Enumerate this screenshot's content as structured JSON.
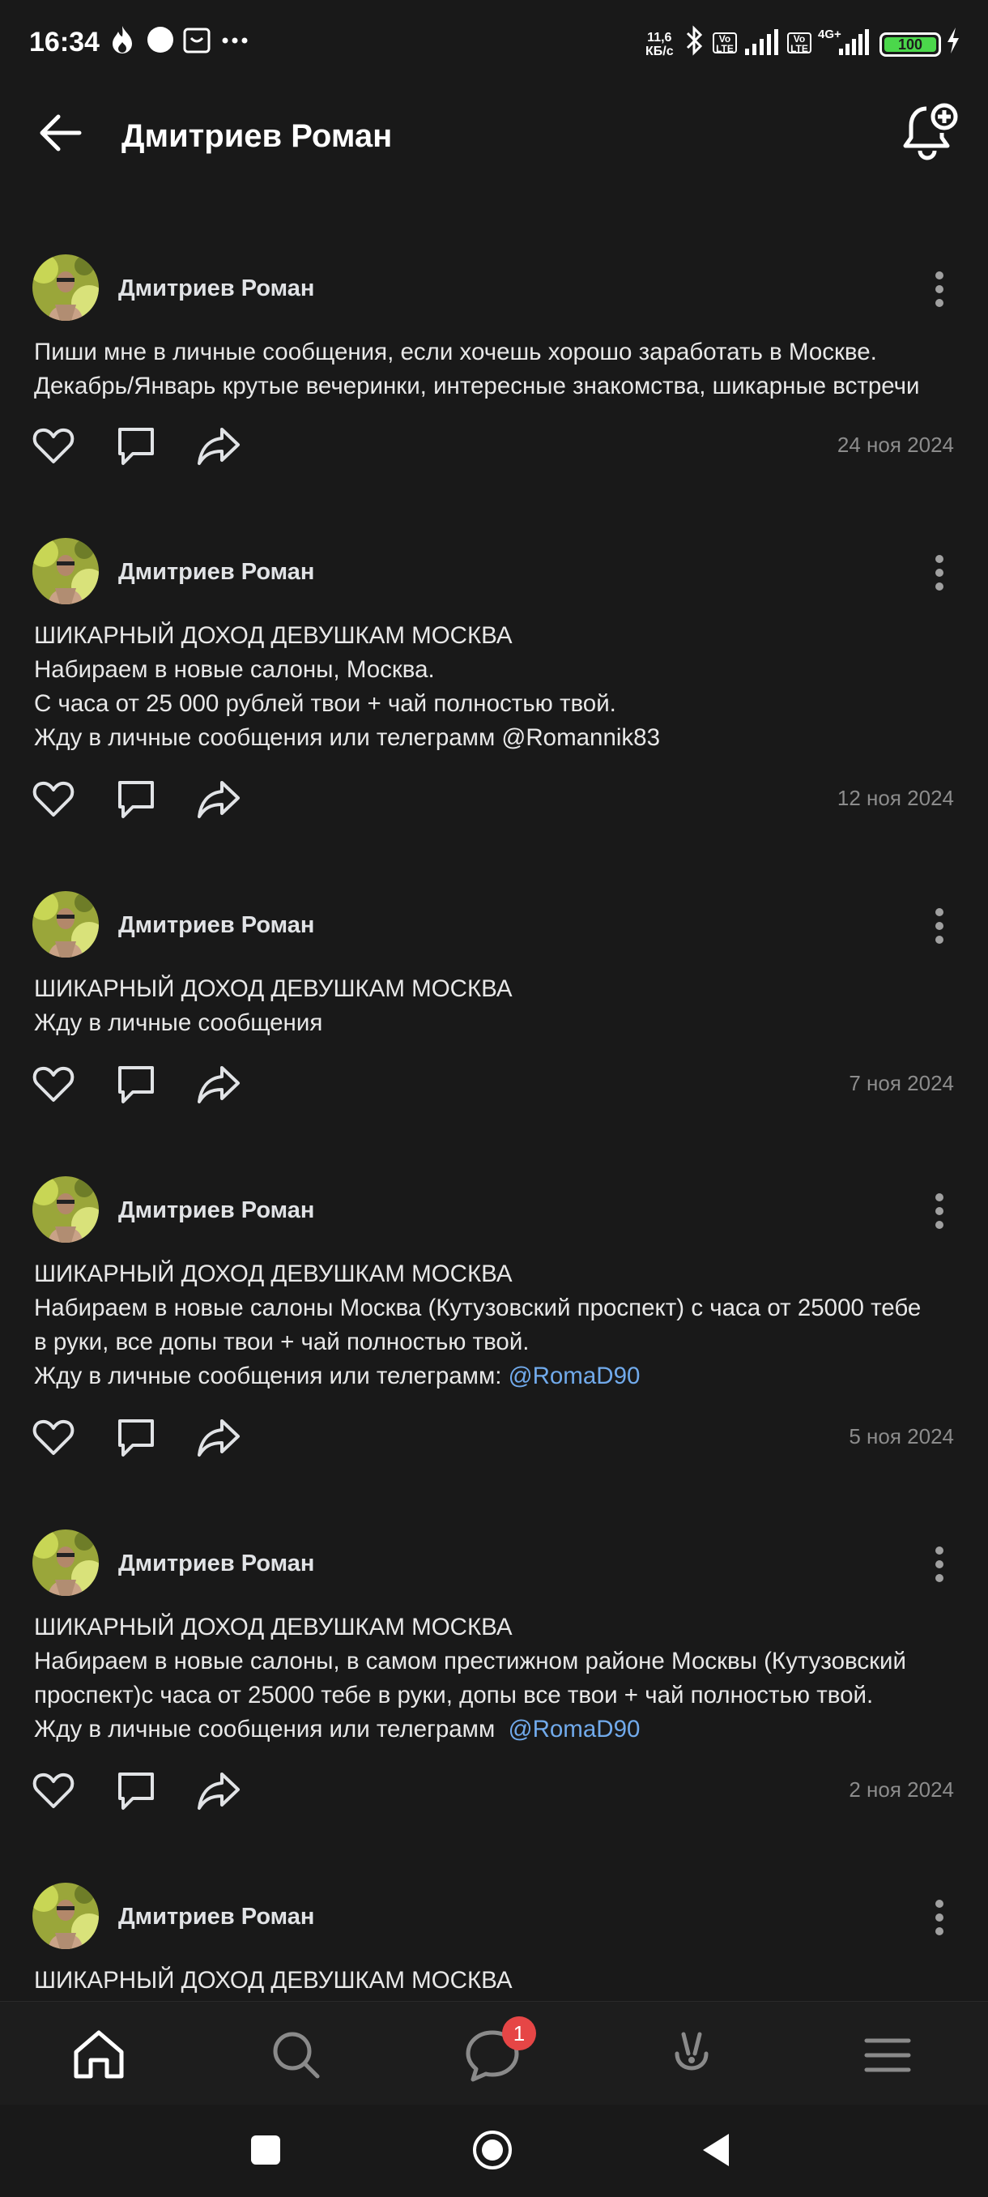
{
  "status_bar": {
    "time": "16:34",
    "net_speed_value": "11,6",
    "net_speed_unit": "КБ/с",
    "lte1": "Vo LTE",
    "lte2": "Vo LTE",
    "network": "4G+",
    "battery": "100",
    "icons": [
      "flame-icon",
      "circle-icon",
      "smile-box-icon",
      "more-dots-icon",
      "bluetooth-icon",
      "signal-icon",
      "charging-icon"
    ]
  },
  "header": {
    "title": "Дмитриев Роман",
    "back_icon": "arrow-left-icon",
    "bell_icon": "bell-plus-icon"
  },
  "posts": [
    {
      "author": "Дмитриев Роман",
      "lines": [
        {
          "text": "Пиши мне в личные сообщения, если хочешь хорошо заработать в Москве."
        },
        {
          "text": "Декабрь/Январь крутые вечеринки, интересные знакомства, шикарные встречи"
        }
      ],
      "date": "24 ноя 2024"
    },
    {
      "author": "Дмитриев Роман",
      "lines": [
        {
          "text": "ШИКАРНЫЙ ДОХОД ДЕВУШКАМ МОСКВА"
        },
        {
          "text": "Набираем в новые салоны, Москва."
        },
        {
          "text": "С часа от 25 000 рублей твои + чай полностью твой."
        },
        {
          "text": "Жду в личные сообщения или телеграмм @Romannik83"
        }
      ],
      "date": "12 ноя 2024"
    },
    {
      "author": "Дмитриев Роман",
      "lines": [
        {
          "text": "ШИКАРНЫЙ ДОХОД ДЕВУШКАМ МОСКВА"
        },
        {
          "text": "Жду в личные сообщения"
        }
      ],
      "date": "7 ноя 2024"
    },
    {
      "author": "Дмитриев Роман",
      "lines": [
        {
          "text": "ШИКАРНЫЙ ДОХОД ДЕВУШКАМ МОСКВА"
        },
        {
          "text": "Набираем в новые салоны Москва (Кутузовский проспект) с часа от 25000 тебе"
        },
        {
          "text": "в руки, все допы твои + чай полностью твой."
        },
        {
          "text": "Жду в личные сообщения или телеграмм: ",
          "mention": "@RomaD90"
        }
      ],
      "date": "5 ноя 2024"
    },
    {
      "author": "Дмитриев Роман",
      "lines": [
        {
          "text": "ШИКАРНЫЙ ДОХОД ДЕВУШКАМ МОСКВА"
        },
        {
          "text": "Набираем в новые салоны, в самом престижном районе Москвы (Кутузовский"
        },
        {
          "text": "проспект)с часа от 25000 тебе в руки, допы все твои + чай полностью твой."
        },
        {
          "text": "Жду в личные сообщения или телеграмм  ",
          "mention": "@RomaD90"
        }
      ],
      "date": "2 ноя 2024"
    },
    {
      "author": "Дмитриев Роман",
      "lines": [
        {
          "text": "ШИКАРНЫЙ ДОХОД ДЕВУШКАМ МОСКВА"
        }
      ],
      "date": ""
    }
  ],
  "post_actions": [
    "heart-icon",
    "comment-icon",
    "share-icon"
  ],
  "bottom_nav": {
    "items": [
      "home-icon",
      "search-icon",
      "messages-icon",
      "clips-icon",
      "menu-icon"
    ],
    "messages_badge": "1"
  },
  "system_nav": [
    "recents-icon",
    "home-circle-icon",
    "back-triangle-icon"
  ]
}
